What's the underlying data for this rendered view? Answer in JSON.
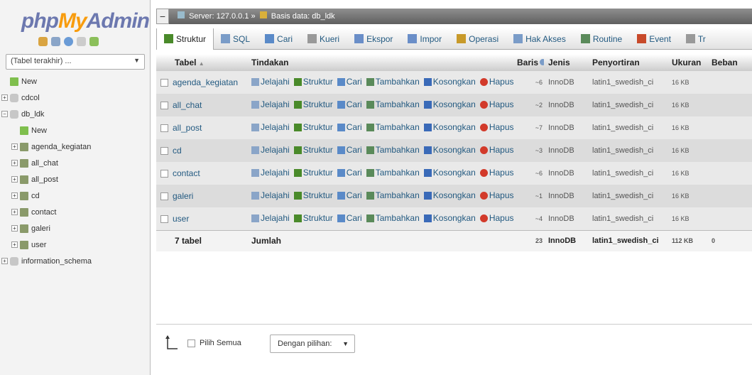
{
  "logo": {
    "php": "php",
    "my": "My",
    "admin": "Admin"
  },
  "sidebar": {
    "recent_placeholder": "(Tabel terakhir) ...",
    "tree": [
      {
        "label": "New",
        "level": 0
      },
      {
        "label": "cdcol",
        "level": 0
      },
      {
        "label": "db_ldk",
        "level": 0
      },
      {
        "label": "New",
        "level": 1
      },
      {
        "label": "agenda_kegiatan",
        "level": 1
      },
      {
        "label": "all_chat",
        "level": 1
      },
      {
        "label": "all_post",
        "level": 1
      },
      {
        "label": "cd",
        "level": 1
      },
      {
        "label": "contact",
        "level": 1
      },
      {
        "label": "galeri",
        "level": 1
      },
      {
        "label": "user",
        "level": 1
      },
      {
        "label": "information_schema",
        "level": 0
      }
    ]
  },
  "breadcrumb": {
    "server": "Server: 127.0.0.1",
    "sep": "»",
    "database": "Basis data: db_ldk"
  },
  "tabs": [
    {
      "label": "Struktur",
      "icon": "structure-icon",
      "color": "#4a8a2a"
    },
    {
      "label": "SQL",
      "icon": "sql-icon",
      "color": "#7a9cc8"
    },
    {
      "label": "Cari",
      "icon": "search-icon",
      "color": "#5a8ac8"
    },
    {
      "label": "Kueri",
      "icon": "query-icon",
      "color": "#999999"
    },
    {
      "label": "Ekspor",
      "icon": "export-icon",
      "color": "#6a8ec8"
    },
    {
      "label": "Impor",
      "icon": "import-icon",
      "color": "#6a8ec8"
    },
    {
      "label": "Operasi",
      "icon": "wrench-icon",
      "color": "#c89a2a"
    },
    {
      "label": "Hak Akses",
      "icon": "privileges-icon",
      "color": "#7a9cc8"
    },
    {
      "label": "Routine",
      "icon": "routine-icon",
      "color": "#5a8a5a"
    },
    {
      "label": "Event",
      "icon": "clock-icon",
      "color": "#c84a2a"
    },
    {
      "label": "Tr",
      "icon": "trigger-icon",
      "color": "#999999"
    }
  ],
  "table": {
    "headers": {
      "tabel": "Tabel",
      "tindakan": "Tindakan",
      "baris": "Baris",
      "jenis": "Jenis",
      "penyortiran": "Penyortiran",
      "ukuran": "Ukuran",
      "beban": "Beban"
    },
    "actions": {
      "jelajahi": "Jelajahi",
      "struktur": "Struktur",
      "cari": "Cari",
      "tambahkan": "Tambahkan",
      "kosongkan": "Kosongkan",
      "hapus": "Hapus"
    },
    "rows": [
      {
        "name": "agenda_kegiatan",
        "rows": "~6",
        "engine": "InnoDB",
        "collation": "latin1_swedish_ci",
        "size": "16 KB"
      },
      {
        "name": "all_chat",
        "rows": "~2",
        "engine": "InnoDB",
        "collation": "latin1_swedish_ci",
        "size": "16 KB"
      },
      {
        "name": "all_post",
        "rows": "~7",
        "engine": "InnoDB",
        "collation": "latin1_swedish_ci",
        "size": "16 KB"
      },
      {
        "name": "cd",
        "rows": "~3",
        "engine": "InnoDB",
        "collation": "latin1_swedish_ci",
        "size": "16 KB"
      },
      {
        "name": "contact",
        "rows": "~6",
        "engine": "InnoDB",
        "collation": "latin1_swedish_ci",
        "size": "16 KB"
      },
      {
        "name": "galeri",
        "rows": "~1",
        "engine": "InnoDB",
        "collation": "latin1_swedish_ci",
        "size": "16 KB"
      },
      {
        "name": "user",
        "rows": "~4",
        "engine": "InnoDB",
        "collation": "latin1_swedish_ci",
        "size": "16 KB"
      }
    ],
    "footer": {
      "count": "7 tabel",
      "label": "Jumlah",
      "rows": "23",
      "engine": "InnoDB",
      "collation": "latin1_swedish_ci",
      "size": "112 KB",
      "overhead": "0"
    }
  },
  "bottom": {
    "select_all": "Pilih Semua",
    "with_selected": "Dengan pilihan:"
  }
}
